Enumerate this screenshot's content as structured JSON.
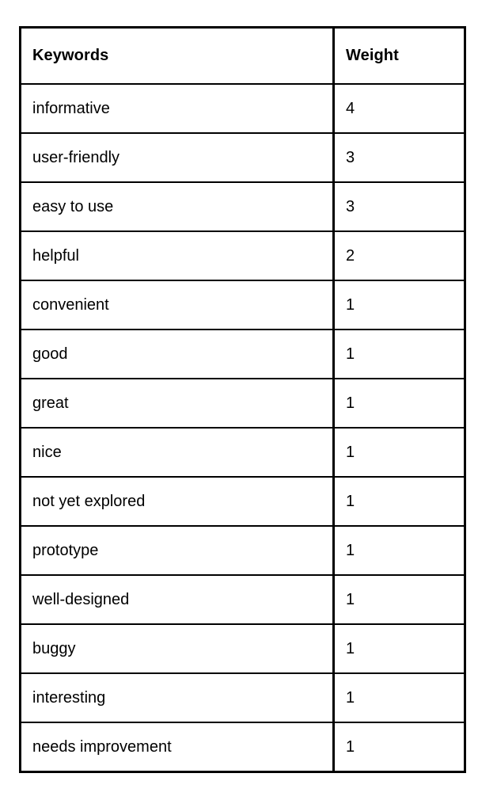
{
  "table": {
    "columns": [
      {
        "key": "keyword",
        "label": "Keywords"
      },
      {
        "key": "weight",
        "label": "Weight"
      }
    ],
    "rows": [
      {
        "keyword": "informative",
        "weight": "4"
      },
      {
        "keyword": "user-friendly",
        "weight": "3"
      },
      {
        "keyword": "easy to use",
        "weight": "3"
      },
      {
        "keyword": "helpful",
        "weight": "2"
      },
      {
        "keyword": "convenient",
        "weight": "1"
      },
      {
        "keyword": "good",
        "weight": "1"
      },
      {
        "keyword": "great",
        "weight": "1"
      },
      {
        "keyword": "nice",
        "weight": "1"
      },
      {
        "keyword": "not yet explored",
        "weight": "1"
      },
      {
        "keyword": "prototype",
        "weight": "1"
      },
      {
        "keyword": "well-designed",
        "weight": "1"
      },
      {
        "keyword": "buggy",
        "weight": "1"
      },
      {
        "keyword": "interesting",
        "weight": "1"
      },
      {
        "keyword": "needs improvement",
        "weight": "1"
      }
    ]
  },
  "colors": {
    "background": "#ffffff",
    "border": "#000000",
    "text": "#000000"
  }
}
